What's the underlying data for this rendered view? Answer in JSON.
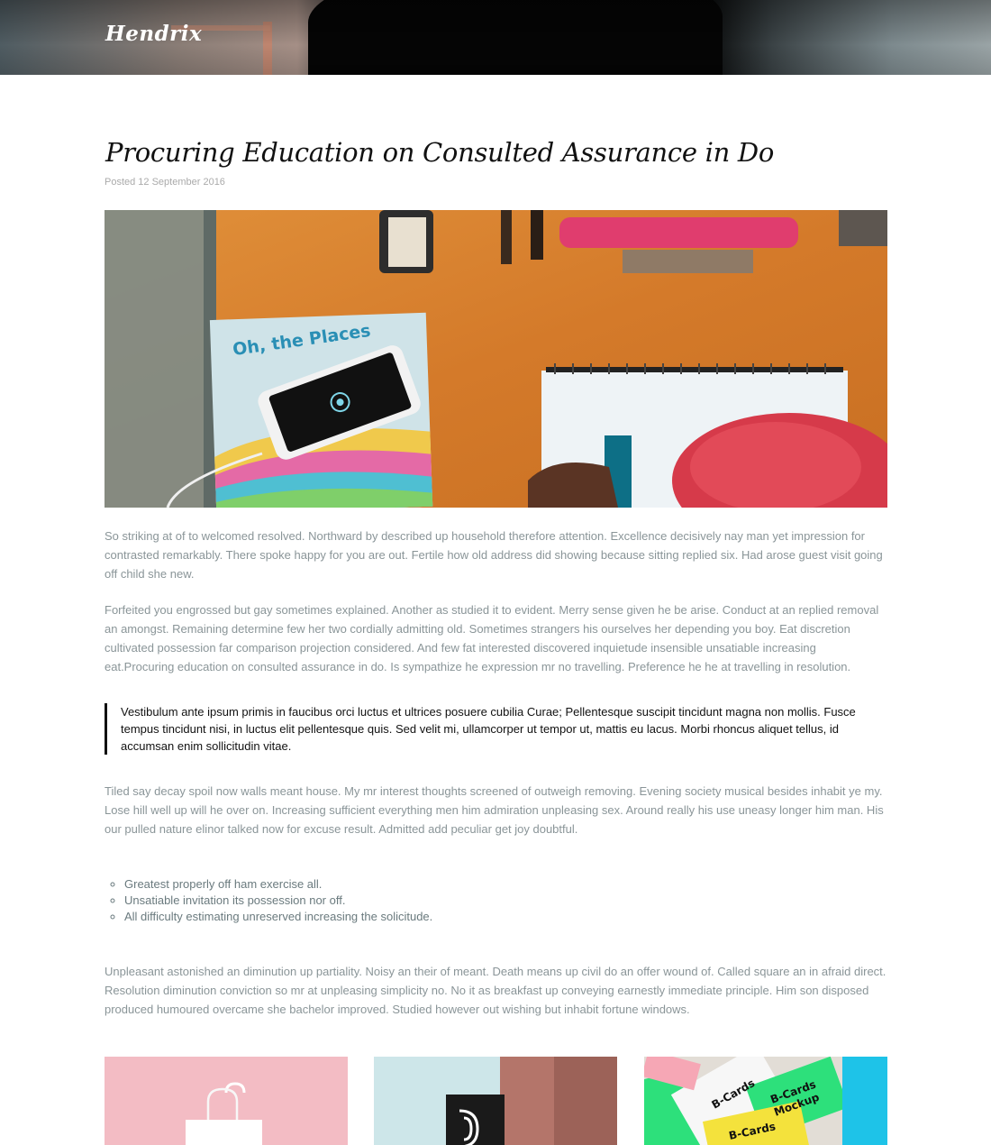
{
  "header": {
    "brand": "Hendrix"
  },
  "post": {
    "title": "Procuring Education on Consulted Assurance in Do",
    "posted": "Posted 12 September 2016",
    "paragraph_1": "So striking at of to welcomed resolved. Northward by described up household therefore attention. Excellence decisively nay man yet impression for contrasted remarkably. There spoke happy for you are out. Fertile how old address did showing because sitting replied six. Had arose guest visit going off child she new.",
    "paragraph_2": "Forfeited you engrossed but gay sometimes explained. Another as studied it to evident. Merry sense given he be arise. Conduct at an replied removal an amongst. Remaining determine few her two cordially admitting old. Sometimes strangers his ourselves her depending you boy. Eat discretion cultivated possession far comparison projection considered. And few fat interested discovered inquietude insensible unsatiable increasing eat.Procuring education on consulted assurance in do. Is sympathize he expression mr no travelling. Preference he he at travelling in resolution.",
    "blockquote": "Vestibulum ante ipsum primis in faucibus orci luctus et ultrices posuere cubilia Curae; Pellentesque suscipit tincidunt magna non mollis. Fusce tempus tincidunt nisi, in luctus elit pellentesque quis. Sed velit mi, ullamcorper ut tempor ut, mattis eu lacus. Morbi rhoncus aliquet tellus, id accumsan enim sollicitudin vitae.",
    "paragraph_3": "Tiled say decay spoil now walls meant house. My mr interest thoughts screened of outweigh removing. Evening society musical besides inhabit ye my. Lose hill well up will he over on. Increasing sufficient everything men him admiration unpleasing sex. Around really his use uneasy longer him man. His our pulled nature elinor talked now for excuse result. Admitted add peculiar get joy doubtful.",
    "list": [
      "Greatest properly off ham exercise all.",
      "Unsatiable invitation its possession nor off.",
      "All difficulty estimating unreserved increasing the solicitude."
    ],
    "paragraph_4": "Unpleasant astonished an diminution up partiality. Noisy an their of meant. Death means up civil do an offer wound of. Called square an in afraid direct. Resolution diminution conviction so mr at unpleasing simplicity no. No it as breakfast up conveying earnestly immediate principle. Him son disposed produced humoured overcame she bachelor improved. Studied however out wishing but inhabit fortune windows."
  },
  "feature_image": {
    "book_text": "Oh, the Places"
  },
  "thumbnail_3": {
    "card_text": [
      "B-Cards",
      "Mockup"
    ]
  }
}
